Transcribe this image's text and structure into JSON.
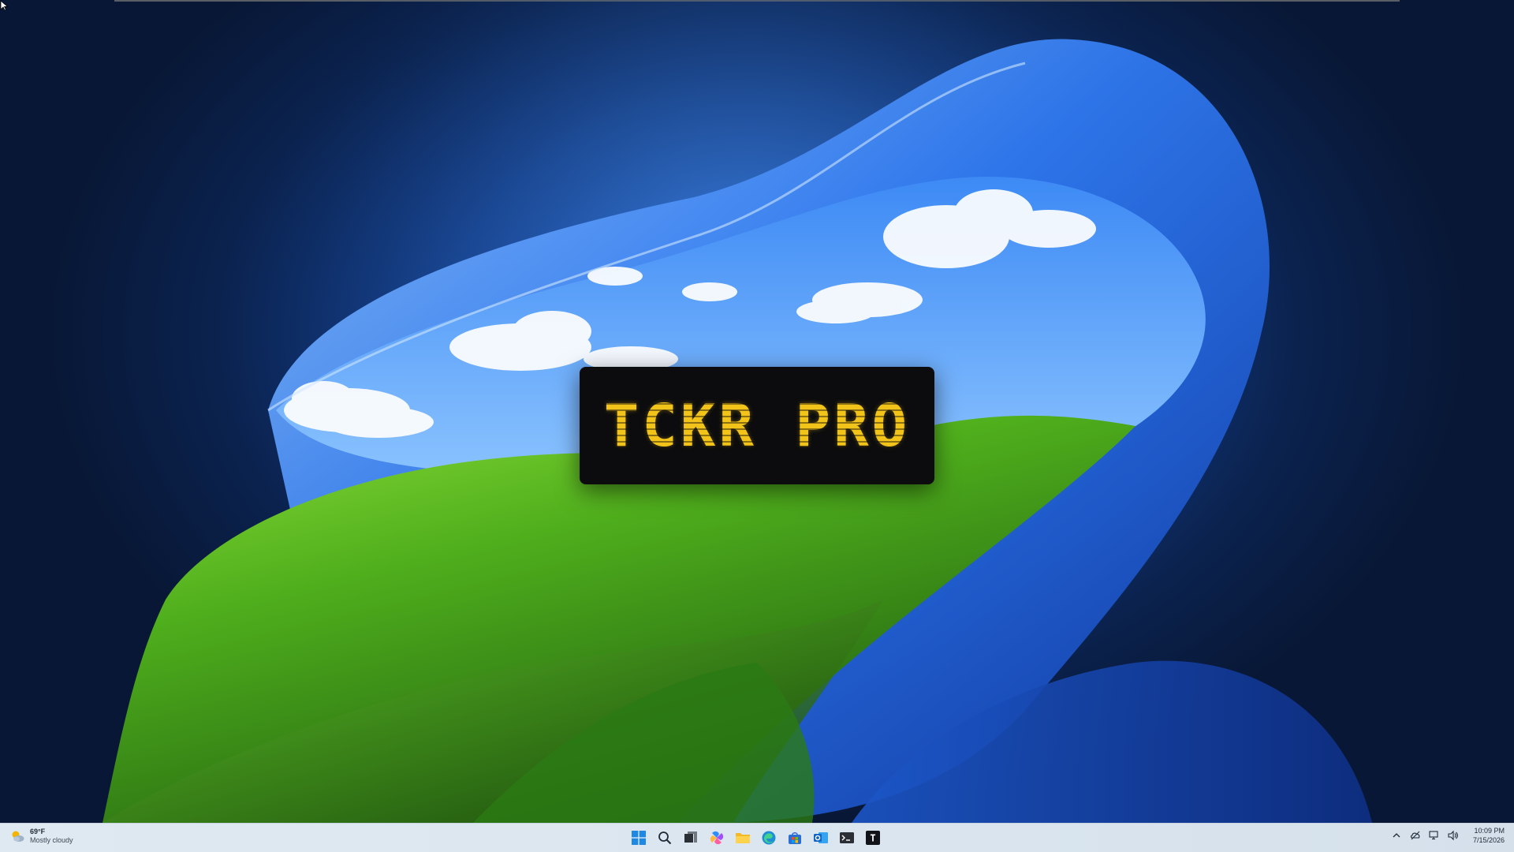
{
  "splash": {
    "title": "TCKR PRO",
    "text_color": "#f2c318",
    "background": "#0c0c0e"
  },
  "taskbar": {
    "weather": {
      "temperature": "69°F",
      "condition": "Mostly cloudy",
      "icon": "partly-cloudy-icon"
    },
    "apps": [
      {
        "name": "start-button",
        "icon": "windows-logo-icon"
      },
      {
        "name": "search-button",
        "icon": "search-icon"
      },
      {
        "name": "task-view-button",
        "icon": "task-view-icon"
      },
      {
        "name": "copilot-button",
        "icon": "copilot-icon"
      },
      {
        "name": "file-explorer-button",
        "icon": "folder-icon"
      },
      {
        "name": "edge-button",
        "icon": "edge-icon"
      },
      {
        "name": "store-button",
        "icon": "store-icon"
      },
      {
        "name": "outlook-button",
        "icon": "outlook-icon"
      },
      {
        "name": "terminal-button",
        "icon": "terminal-icon"
      },
      {
        "name": "tckr-app-button",
        "icon": "tckr-app-icon",
        "label": "T"
      }
    ],
    "tray": {
      "time": "10:09 PM",
      "date": "7/15/2026"
    }
  }
}
